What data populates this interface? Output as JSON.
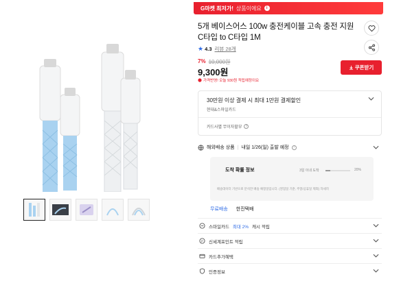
{
  "promo": {
    "highlight": "G마켓 최저가!",
    "sub": "상품이에요",
    "badge": "i"
  },
  "product": {
    "title": "5개 베이스어스 100w 충전케이블 고속 충전 지원 C타입 to C타입 1M",
    "rating_star": "★",
    "rating": "4.3",
    "review_label": "리뷰 28개",
    "discount_pct": "7%",
    "original_price": "10,000원",
    "price": "9,300원",
    "price_note": "가격반영! 오늘 930원 적립예정이요",
    "coupon_label": "쿠폰받기",
    "coupon_icon": "download-icon"
  },
  "card_benefit": {
    "title": "30만원 이상 결제 시 최대 1만원 결제할인",
    "card_name": "현대&스마일카드",
    "installment": "카드사별 무이자할부"
  },
  "shipping": {
    "label": "해외배송 상품",
    "eta": "내일 1/26(일) 출발 예정",
    "prob_title": "도착 확률 정보",
    "prob_days": "3일 이내 도착",
    "prob_percent": "20%",
    "prob_value": 0.2,
    "prob_note": "배송데이터 기반으로 분석한 배송 예정일입니다. (영업일 기준, 주말/공휴일 제외) 자세히",
    "free_label": "무료배송",
    "courier": "한진택배"
  },
  "menu": [
    {
      "name": "menu-smilecard-cashback",
      "icon": "coin-icon",
      "pre": "스마일카드",
      "highlight": "최대 2%",
      "post": "캐시 적립"
    },
    {
      "name": "menu-shinsegae-point",
      "icon": "point-icon",
      "pre": "신세계포인트 적립",
      "highlight": "",
      "post": ""
    },
    {
      "name": "menu-card-benefits",
      "icon": "card-icon",
      "pre": "카드추가혜택",
      "highlight": "",
      "post": ""
    },
    {
      "name": "menu-certification",
      "icon": "shield-icon",
      "pre": "인증정보",
      "highlight": "",
      "post": ""
    }
  ],
  "colors": {
    "accent": "#e8202e",
    "link": "#2e6be6",
    "cable_blue": "#a9d2f0",
    "cable_white": "#eef0f2"
  }
}
